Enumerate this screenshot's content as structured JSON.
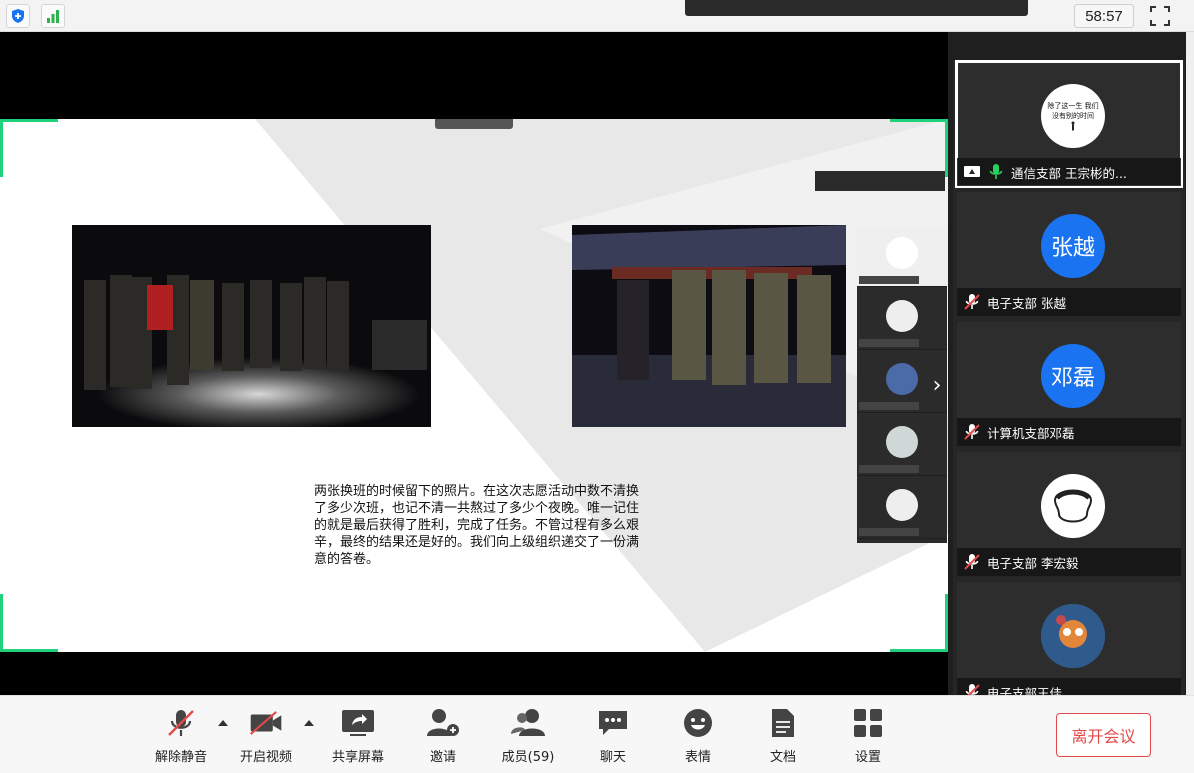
{
  "topbar": {
    "timer": "58:57"
  },
  "slide": {
    "caption": "两张换班的时候留下的照片。在这次志愿活动中数不清换了多少次班，也记不清一共熬过了多少个夜晚。唯一记住的就是最后获得了胜利，完成了任务。不管过程有多么艰辛，最终的结果还是好的。我们向上级组织递交了一份满意的答卷。"
  },
  "participants": [
    {
      "label": "通信支部  王宗彬的...",
      "mic": "on",
      "sharing": true,
      "avatar_text": "除了这一生 我们没有别的时间",
      "avatar_type": "image-white"
    },
    {
      "label": "电子支部  张越",
      "mic": "muted",
      "avatar_text": "张越",
      "avatar_type": "blue"
    },
    {
      "label": "计算机支部邓磊",
      "mic": "muted",
      "avatar_text": "邓磊",
      "avatar_type": "blue"
    },
    {
      "label": "电子支部  李宏毅",
      "mic": "muted",
      "avatar_text": "",
      "avatar_type": "image-white"
    },
    {
      "label": "电子支部王佳",
      "mic": "muted",
      "avatar_text": "",
      "avatar_type": "image-color"
    }
  ],
  "toolbar": {
    "unmute": "解除静音",
    "start_video": "开启视频",
    "share_screen": "共享屏幕",
    "invite": "邀请",
    "members": "成员(59)",
    "chat": "聊天",
    "reactions": "表情",
    "docs": "文档",
    "settings": "设置",
    "leave": "离开会议"
  },
  "colors": {
    "accent_green": "#1fd17a",
    "avatar_blue": "#1a73f0",
    "leave_red": "#e24a4a"
  }
}
